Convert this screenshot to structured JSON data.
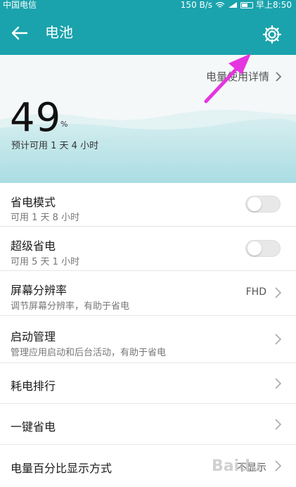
{
  "status_bar": {
    "carrier": "中国电信",
    "speed": "150 B/s",
    "time": "早上8:50"
  },
  "app_bar": {
    "title": "电池",
    "back_icon": "arrow-left-icon",
    "settings_icon": "gear-icon"
  },
  "hero": {
    "detail_link": "电量使用详情",
    "percent": "49",
    "percent_sign": "%",
    "estimate": "预计可用 1 天 4 小时"
  },
  "rows": [
    {
      "title": "省电模式",
      "sub": "可用 1 天 8 小时",
      "control": "toggle",
      "on": false
    },
    {
      "title": "超级省电",
      "sub": "可用 5 天 1 小时",
      "control": "toggle",
      "on": false
    },
    {
      "title": "屏幕分辨率",
      "sub": "调节屏幕分辨率，有助于省电",
      "control": "chevron",
      "value": "FHD"
    },
    {
      "title": "启动管理",
      "sub": "管理应用启动和后台活动，有助于省电",
      "control": "chevron"
    },
    {
      "title": "耗电排行",
      "control": "chevron"
    },
    {
      "title": "一键省电",
      "control": "chevron"
    },
    {
      "title": "电量百分比显示方式",
      "control": "chevron",
      "value": "不显示"
    }
  ],
  "watermark": "Baidu",
  "colors": {
    "accent": "#1aa3ad",
    "annotation_arrow": "#e535e0"
  }
}
